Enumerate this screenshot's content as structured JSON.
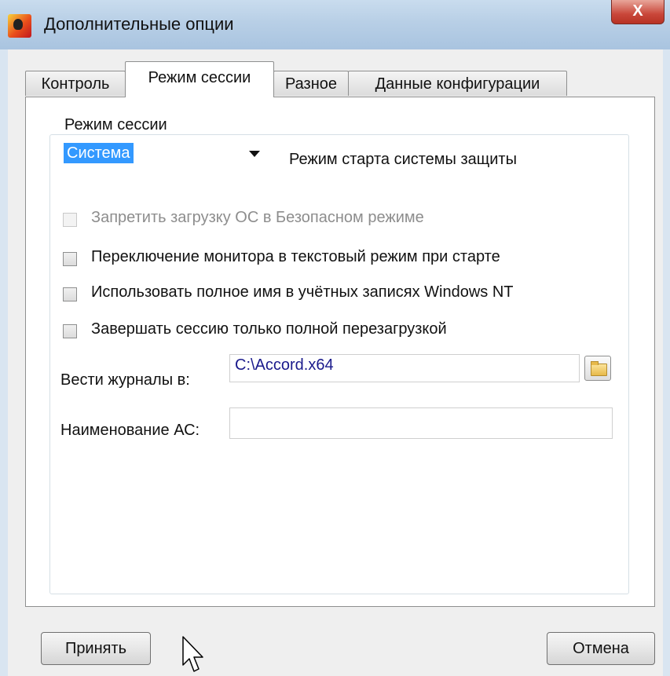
{
  "window": {
    "title": "Дополнительные опции",
    "close_glyph": "X",
    "icon": "app-icon"
  },
  "tabs": [
    {
      "label": "Контроль",
      "active": false
    },
    {
      "label": "Режим сессии",
      "active": true
    },
    {
      "label": "Разное",
      "active": false
    },
    {
      "label": "Данные конфигурации",
      "active": false
    }
  ],
  "session": {
    "group_label": "Режим сессии",
    "mode_value": "Система",
    "mode_description": "Режим старта системы защиты"
  },
  "options": [
    {
      "label": "Запретить загрузку ОС в Безопасном режиме",
      "checked": false,
      "enabled": false
    },
    {
      "label": "Переключение монитора в текстовый режим при старте",
      "checked": false,
      "enabled": true
    },
    {
      "label": "Использовать полное имя в учётных записях Windows NT",
      "checked": false,
      "enabled": true
    },
    {
      "label": "Завершать сессию только полной перезагрузкой",
      "checked": false,
      "enabled": true
    }
  ],
  "logs": {
    "label": "Вести журналы в:",
    "path": "C:\\Accord.x64",
    "browse_icon": "folder-icon"
  },
  "as_name": {
    "label": "Наименование АС:",
    "value": ""
  },
  "buttons": {
    "accept": "Принять",
    "cancel": "Отмена"
  },
  "colors": {
    "selection": "#3399ff",
    "titlebar": "#b8cfe6",
    "close_button": "#c9473a",
    "path_text": "#1a1a8c"
  }
}
